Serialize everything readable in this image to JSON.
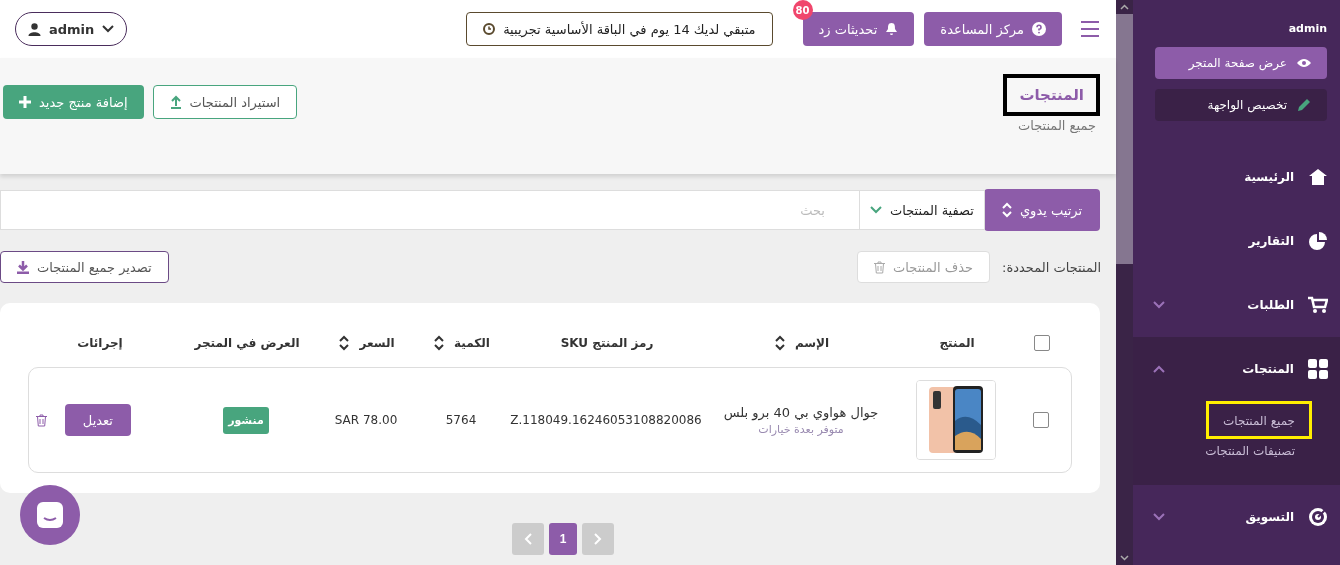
{
  "topbar": {
    "help": "مركز المساعدة",
    "updates": "تحديثات زد",
    "updates_badge": "80",
    "trial": "متبقي لديك 14 يوم في الباقة الأساسية تجريبية",
    "user": "admin"
  },
  "page_header": {
    "title": "المنتجات",
    "title_highlighted": true,
    "subtitle": "جميع المنتجات",
    "add_button": "إضافة منتج جديد",
    "import_button": "استيراد المنتجات"
  },
  "toolbar": {
    "sort": "ترتيب يدوي",
    "filter": "تصفية المنتجات",
    "search_placeholder": "بحث",
    "selected_label": "المنتجات المحددة:",
    "delete_button": "حذف المنتجات",
    "delete_disabled": true,
    "export_button": "تصدير جميع المنتجات"
  },
  "table": {
    "all_checked": false,
    "columns": [
      {
        "label": "المنتج",
        "sortable": false
      },
      {
        "label": "الإسم",
        "sortable": true
      },
      {
        "label": "رمز المنتج SKU",
        "sortable": false
      },
      {
        "label": "الكمية",
        "sortable": true
      },
      {
        "label": "السعر",
        "sortable": true
      },
      {
        "label": "العرض في المتجر",
        "sortable": false
      },
      {
        "label": "إجرائات",
        "sortable": false
      }
    ],
    "rows": [
      {
        "checked": false,
        "name": "جوال هواوي بي 40 برو بلس",
        "note": "متوفر بعدة خيارات",
        "sku": "Z.118049.16246053108820086",
        "quantity": "5764",
        "price": "SAR 78.00",
        "status": "منشور",
        "edit": "تعديل"
      }
    ]
  },
  "pagination": {
    "pages": [
      {
        "label": "1",
        "selected": true
      }
    ]
  },
  "sidebar": {
    "user": "admin",
    "view_store": "عرض صفحة المتجر",
    "customize": "تخصيص الواجهة",
    "items": [
      {
        "label": "الرئيسية",
        "kind": "link"
      },
      {
        "label": "التقارير",
        "kind": "link"
      },
      {
        "label": "الطلبات",
        "kind": "group",
        "expanded": false
      },
      {
        "label": "المنتجات",
        "kind": "group",
        "expanded": true,
        "children": [
          {
            "label": "جميع المنتجات",
            "highlighted": true
          },
          {
            "label": "تصنيفات المنتجات",
            "highlighted": false
          }
        ]
      },
      {
        "label": "التسويق",
        "kind": "group",
        "expanded": false
      }
    ]
  }
}
